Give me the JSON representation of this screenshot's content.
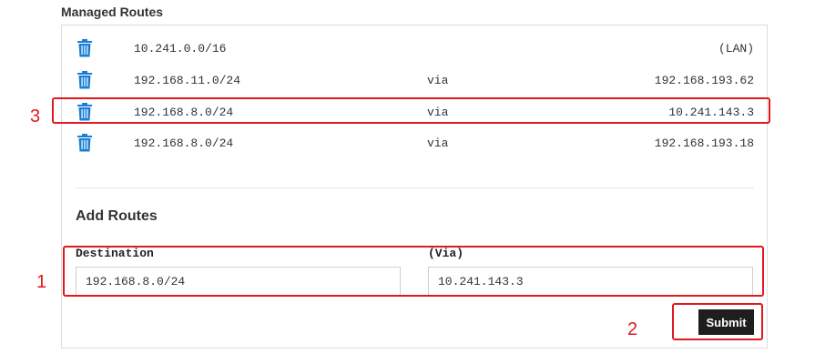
{
  "section_title": "Managed Routes",
  "routes": [
    {
      "destination": "10.241.0.0/16",
      "via": "",
      "gateway": "(LAN)"
    },
    {
      "destination": "192.168.11.0/24",
      "via": "via",
      "gateway": "192.168.193.62"
    },
    {
      "destination": "192.168.8.0/24",
      "via": "via",
      "gateway": "10.241.143.3"
    },
    {
      "destination": "192.168.8.0/24",
      "via": "via",
      "gateway": "192.168.193.18"
    }
  ],
  "add_routes": {
    "title": "Add Routes",
    "destination_label": "Destination",
    "destination_value": "192.168.8.0/24",
    "via_label": "(Via)",
    "via_value": "10.241.143.3",
    "submit_label": "Submit"
  },
  "annotations": [
    "1",
    "2",
    "3"
  ],
  "colors": {
    "trash_icon": "#1a7fd6",
    "annotation": "#e0191f",
    "submit_bg": "#1e1e1e"
  },
  "icons": {
    "delete": "trash-icon"
  }
}
